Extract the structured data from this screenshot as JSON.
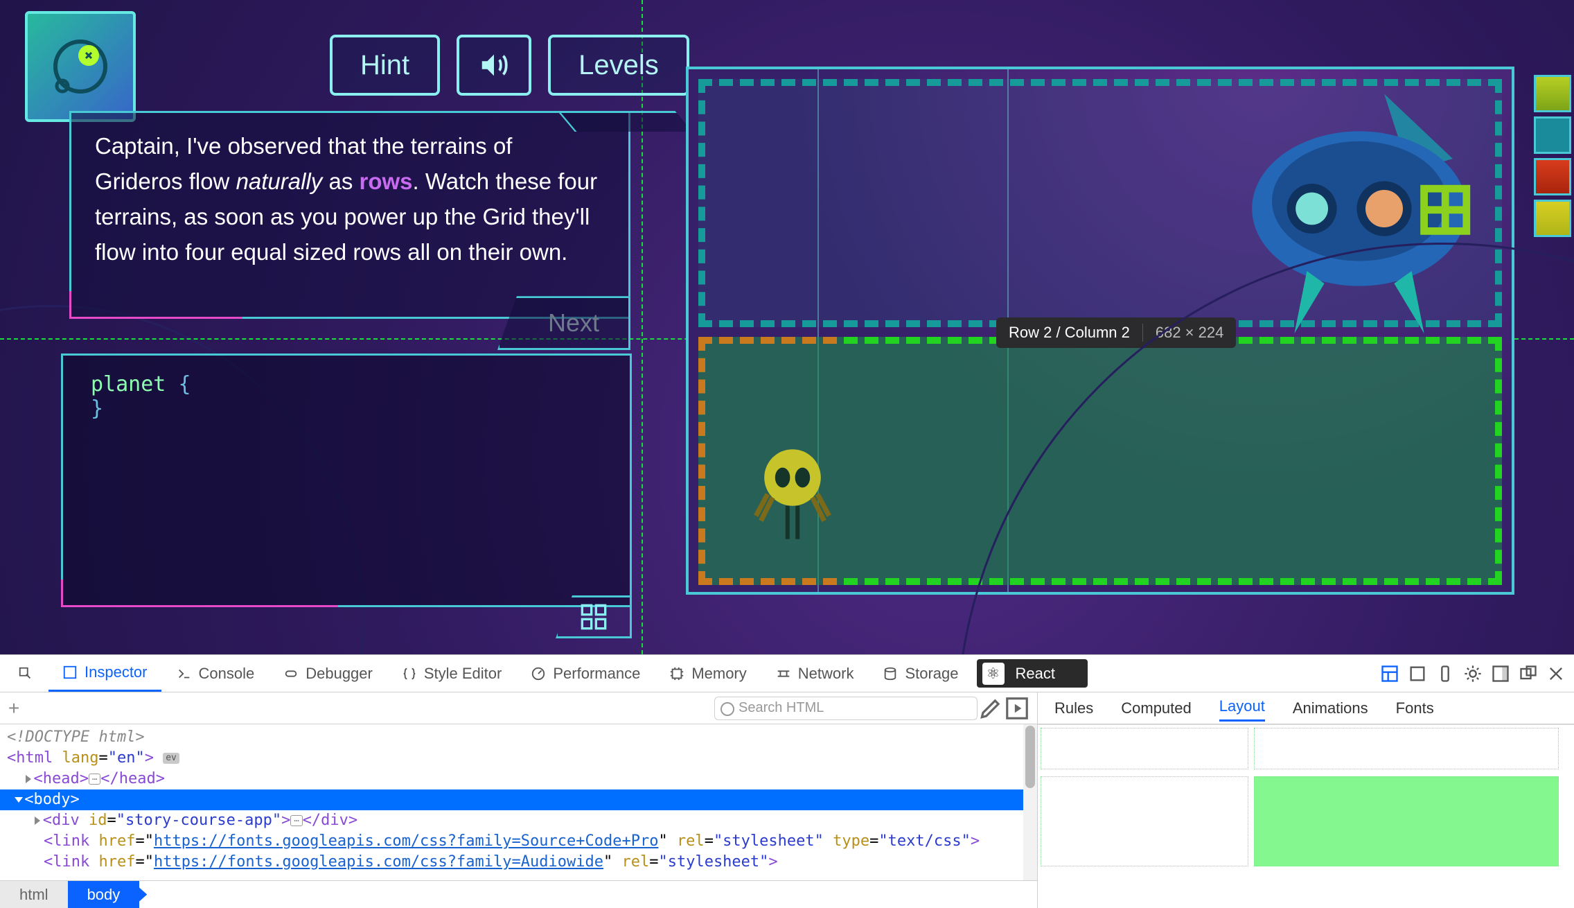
{
  "toolbar": {
    "hint_label": "Hint",
    "levels_label": "Levels",
    "next_label": "Next"
  },
  "dialog": {
    "pre": "Captain, I've observed that the terrains of Grideros flow ",
    "em": "naturally",
    "mid": " as ",
    "kw": "rows",
    "post": ". Watch these four terrains, as soon as you power up the Grid they'll flow into four equal sized rows all on their own."
  },
  "editor": {
    "selector": "planet",
    "caret_line": "  "
  },
  "grid_hud": {
    "cell": "Row 2 / Column 2",
    "dim": "682 × 224"
  },
  "devtools": {
    "tabs": [
      "Inspector",
      "Console",
      "Debugger",
      "Style Editor",
      "Performance",
      "Memory",
      "Network",
      "Storage",
      "React"
    ],
    "search_placeholder": "Search HTML",
    "subtabs": [
      "Rules",
      "Computed",
      "Layout",
      "Animations",
      "Fonts"
    ],
    "tree": {
      "doctype": "<!DOCTYPE html>",
      "html_open": "<html lang=\"en\">",
      "head": "<head>",
      "head_close": "</head>",
      "body": "<body>",
      "div": "<div id=\"story-course-app\">",
      "div_close": "</div>",
      "link1_pre": "<link href=\"",
      "link1_url": "https://fonts.googleapis.com/css?family=Source+Code+Pro",
      "link1_post": "\" rel=\"stylesheet\" type=\"text/css\">",
      "link2_pre": "<link href=\"",
      "link2_url": "https://fonts.googleapis.com/css?family=Audiowide",
      "link2_post": "\" rel=\"stylesheet\">",
      "ev_badge": "ev",
      "fold": "⋯"
    },
    "crumbs": [
      "html",
      "body"
    ]
  }
}
